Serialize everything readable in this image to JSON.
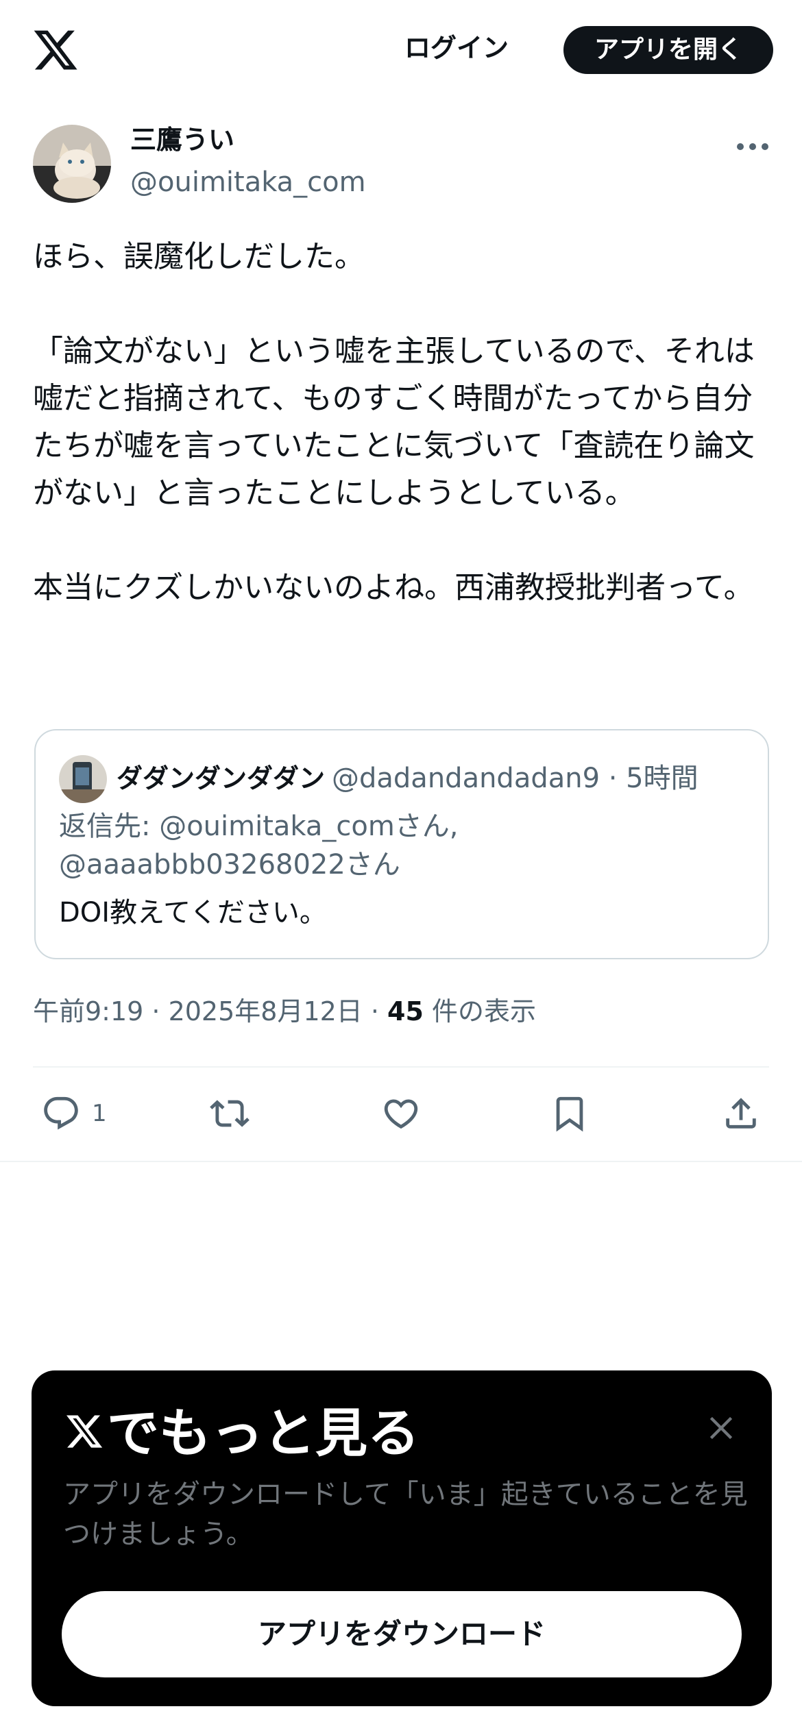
{
  "header": {
    "logo_icon": "x-logo-icon",
    "login_label": "ログイン",
    "open_app_label": "アプリを開く"
  },
  "post": {
    "author_name": "三鷹うい",
    "author_handle": "@ouimitaka_com",
    "more_icon": "more-dots-icon",
    "text": "ほら、誤魔化しだした。\n\n「論文がない」という嘘を主張しているので、それは嘘だと指摘されて、ものすごく時間がたってから自分たちが嘘を言っていたことに気づいて「査読在り論文がない」と言ったことにしようとしている。\n\n本当にクズしかいないのよね。西浦教授批判者って。",
    "timestamp": "午前9:19 · 2025年8月12日 · ",
    "views_count": "45",
    "views_label": " 件の表示"
  },
  "quote": {
    "author_name": "ダダンダンダダン",
    "meta": "@dadandandadan9 · 5時間",
    "reply_to": "返信先: @ouimitaka_comさん, @aaaabbb03268022さん",
    "text": "DOI教えてください。"
  },
  "actions": {
    "reply_count": "1",
    "icons": [
      "reply-icon",
      "repost-icon",
      "like-icon",
      "bookmark-icon",
      "share-icon"
    ]
  },
  "promo": {
    "title": "でもっと見る",
    "subtitle": "アプリをダウンロードして「いま」起きていることを見つけましょう。",
    "button_label": "アプリをダウンロード",
    "close_icon": "close-icon"
  },
  "colors": {
    "text_primary": "#0f1419",
    "text_secondary": "#536471",
    "border": "#cfd9de",
    "promo_bg": "#000000"
  }
}
